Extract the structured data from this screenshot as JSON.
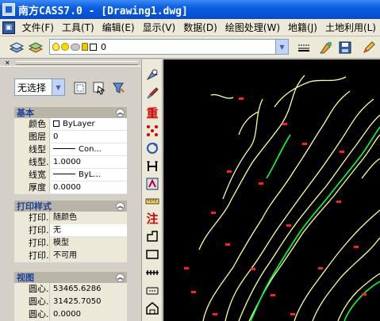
{
  "window": {
    "title": "南方CASS7.0 - [Drawing1.dwg]"
  },
  "menu": {
    "items": [
      "文件(F)",
      "工具(T)",
      "编辑(E)",
      "显示(V)",
      "数据(D)",
      "绘图处理(W)",
      "地籍(J)",
      "土地利用(L)"
    ]
  },
  "toolbar": {
    "current_layer": "0",
    "tools": [
      "layers-icon",
      "layer-states-icon",
      "bulb-icon",
      "sun-icon",
      "freeze-icon",
      "lock-icon",
      "color-swatch",
      "linetype-icon",
      "match-properties-icon",
      "save-icon",
      "pencil-icon"
    ]
  },
  "properties": {
    "selection": "无选择",
    "sections": {
      "basic": {
        "title": "基本",
        "rows": [
          {
            "key": "颜色",
            "value": "ByLayer"
          },
          {
            "key": "图层",
            "value": "0"
          },
          {
            "key": "线型",
            "value": "Con..."
          },
          {
            "key": "线型...",
            "value": "1.0000"
          },
          {
            "key": "线宽",
            "value": "ByL..."
          },
          {
            "key": "厚度",
            "value": "0.0000"
          }
        ]
      },
      "plot_style": {
        "title": "打印样式",
        "rows": [
          {
            "key": "打印...",
            "value": "随颜色"
          },
          {
            "key": "打印...",
            "value": "无"
          },
          {
            "key": "打印...",
            "value": "模型"
          },
          {
            "key": "打印...",
            "value": "不可用"
          }
        ]
      },
      "view": {
        "title": "视图",
        "rows": [
          {
            "key": "圆心...",
            "value": "53465.6286"
          },
          {
            "key": "圆心...",
            "value": "31425.7050"
          },
          {
            "key": "圆心...",
            "value": "0.0000"
          }
        ]
      }
    }
  },
  "vertical_tools": [
    {
      "name": "zoom-icon",
      "label": ""
    },
    {
      "name": "brush-icon",
      "label": ""
    },
    {
      "name": "repeat-glyph",
      "label": "重"
    },
    {
      "name": "points-icon",
      "label": ""
    },
    {
      "name": "rotate-icon",
      "label": ""
    },
    {
      "name": "text-h-icon",
      "label": ""
    },
    {
      "name": "edit-icon",
      "label": ""
    },
    {
      "name": "ruler-icon",
      "label": ""
    },
    {
      "name": "annotate-glyph",
      "label": "注"
    },
    {
      "name": "corner-icon",
      "label": ""
    },
    {
      "name": "rect-icon",
      "label": ""
    },
    {
      "name": "fence-icon",
      "label": ""
    },
    {
      "name": "dimension-icon",
      "label": ""
    },
    {
      "name": "house-icon",
      "label": ""
    }
  ],
  "colors": {
    "canvas": "#000000",
    "contour_primary": "#ffff99",
    "contour_index": "#00ff44",
    "elevation_marks": "#ff2020",
    "titlebar": "#0a5fdf",
    "section_title": "#1c3f94"
  }
}
